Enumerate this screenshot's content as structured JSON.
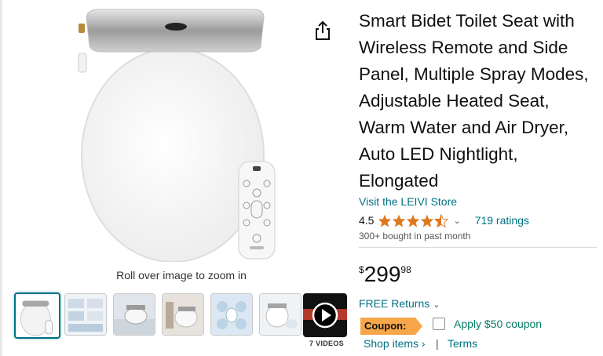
{
  "product": {
    "title": "Smart Bidet Toilet Seat with Wireless Remote and Side Panel, Multiple Spray Modes, Adjustable Heated Seat, Warm Water and Air Dryer, Auto LED Nightlight, Elongated",
    "store_link": "Visit the LEIVI Store",
    "rating_value": "4.5",
    "rating_stars": 4.5,
    "ratings_count": "719 ratings",
    "bought_text": "300+ bought in past month",
    "price_symbol": "$",
    "price_whole": "299",
    "price_fraction": "98",
    "returns_label": "FREE Returns",
    "coupon_badge": "Coupon:",
    "coupon_apply": "Apply $50 coupon",
    "shop_items": "Shop items ›",
    "separator": "|",
    "terms": "Terms"
  },
  "gallery": {
    "zoom_hint": "Roll over image to zoom in",
    "video_label": "7 VIDEOS",
    "thumbnail_count": 6
  },
  "colors": {
    "link": "#007185",
    "coupon_badge": "#f7a64a",
    "coupon_text": "#067d62",
    "star": "#de7921",
    "active_thumb_border": "#007185"
  },
  "icons": {
    "share": "share-icon",
    "play": "play-icon",
    "chevron": "chevron-down-icon"
  }
}
